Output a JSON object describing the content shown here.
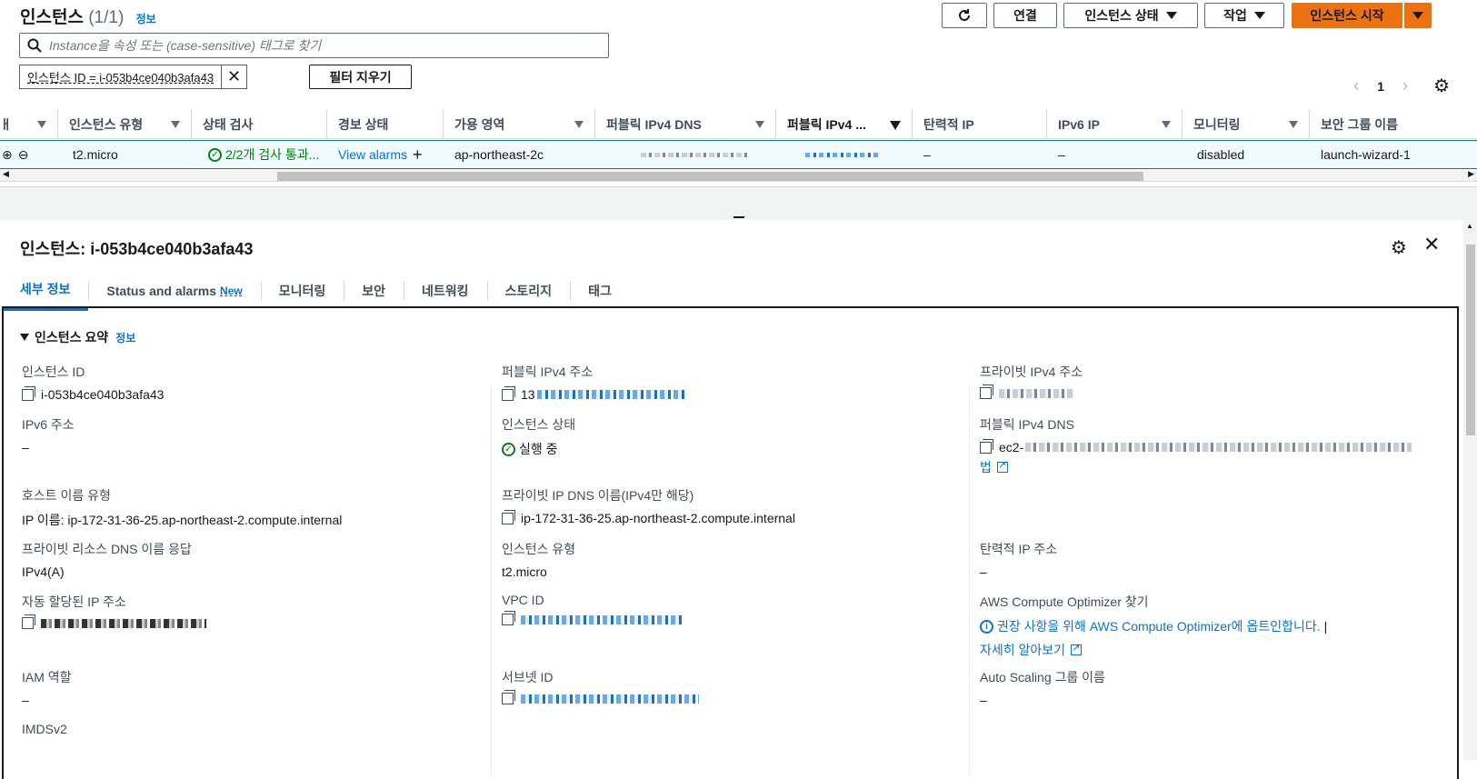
{
  "header": {
    "title": "인스턴스",
    "count": "(1/1)",
    "info": "정보",
    "buttons": {
      "connect": "연결",
      "instance_state": "인스턴스 상태",
      "actions": "작업",
      "launch": "인스턴스 시작"
    },
    "search_placeholder": "Instance을 속성 또는 (case-sensitive) 태그로 찾기",
    "filter_chip": "인스턴스 ID = i-053b4ce040b3afa43",
    "clear_filters": "필터 지우기",
    "page": "1"
  },
  "table": {
    "columns": [
      "인스턴스 유형",
      "상태 검사",
      "경보 상태",
      "가용 영역",
      "퍼블릭 IPv4 DNS",
      "퍼블릭 IPv4 ...",
      "탄력적 IP",
      "IPv6 IP",
      "모니터링",
      "보안 그룹 이름"
    ],
    "row": {
      "type": "t2.micro",
      "status_check": "2/2개 검사 통과...",
      "alarm": "View alarms",
      "az": "ap-northeast-2c",
      "eip": "–",
      "ipv6": "–",
      "monitoring": "disabled",
      "sg": "launch-wizard-1"
    }
  },
  "detail": {
    "title": "인스턴스: i-053b4ce040b3afa43",
    "tabs": [
      "세부 정보",
      "Status and alarms",
      "모니터링",
      "보안",
      "네트워킹",
      "스토리지",
      "태그"
    ],
    "tab_new_badge": "New",
    "section": "인스턴스 요약",
    "section_info": "정보",
    "fields": {
      "instance_id_label": "인스턴스 ID",
      "instance_id": "i-053b4ce040b3afa43",
      "ipv6_label": "IPv6 주소",
      "ipv6": "–",
      "hostname_type_label": "호스트 이름 유형",
      "hostname_type": "IP 이름: ip-172-31-36-25.ap-northeast-2.compute.internal",
      "private_dns_resp_label": "프라이빗 리소스 DNS 이름 응답",
      "private_dns_resp": "IPv4(A)",
      "auto_ip_label": "자동 할당된 IP 주소",
      "iam_label": "IAM 역할",
      "iam": "–",
      "imds_label": "IMDSv2",
      "public_ipv4_label": "퍼블릭 IPv4 주소",
      "public_ipv4_prefix": "13",
      "state_label": "인스턴스 상태",
      "state": "실행 중",
      "private_ip_dns_label": "프라이빗 IP DNS 이름(IPv4만 해당)",
      "private_ip_dns": "ip-172-31-36-25.ap-northeast-2.compute.internal",
      "type_label": "인스턴스 유형",
      "type": "t2.micro",
      "vpc_label": "VPC ID",
      "subnet_label": "서브넷 ID",
      "private_ipv4_label": "프라이빗 IPv4 주소",
      "public_dns_label": "퍼블릭 IPv4 DNS",
      "public_dns_prefix": "ec2-",
      "public_dns_link": "법",
      "eip_label": "탄력적 IP 주소",
      "eip": "–",
      "optimizer_label": "AWS Compute Optimizer 찾기",
      "optimizer_text": "권장 사항을 위해 AWS Compute Optimizer에 옵트인합니다.",
      "learn_more": "자세히 알아보기",
      "asg_label": "Auto Scaling 그룹 이름",
      "asg": "–"
    }
  }
}
